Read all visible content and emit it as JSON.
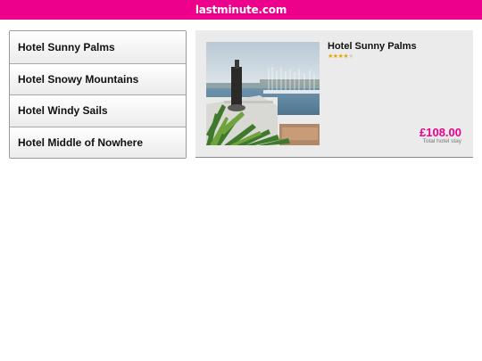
{
  "header": {
    "logo_text": "lastminute.com",
    "brand_color": "#ec008c"
  },
  "hotel_list": {
    "items": [
      {
        "label": "Hotel Sunny Palms"
      },
      {
        "label": "Hotel Snowy Mountains"
      },
      {
        "label": "Hotel Windy Sails"
      },
      {
        "label": "Hotel Middle of Nowhere"
      }
    ]
  },
  "detail": {
    "title": "Hotel Sunny Palms",
    "star_rating": 4,
    "star_max": 5,
    "price": "£108.00",
    "price_caption": "Total hotel stay",
    "photo": "hotel-photo"
  }
}
